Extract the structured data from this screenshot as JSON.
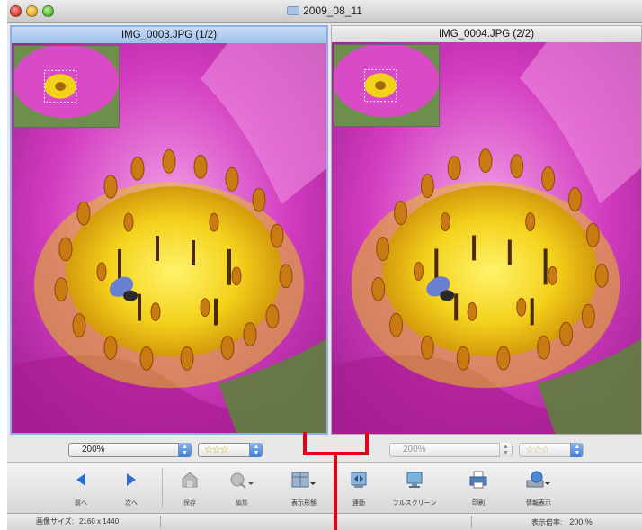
{
  "window": {
    "title": "2009_08_11"
  },
  "panels": {
    "left": {
      "filename": "IMG_0003.JPG (1/2)",
      "zoom": "200%",
      "rating": "☆☆☆"
    },
    "right": {
      "filename": "IMG_0004.JPG (2/2)",
      "zoom": "200%",
      "rating": "☆☆☆"
    }
  },
  "toolbar": {
    "items": [
      {
        "label": "前へ",
        "icon": "arrow-left-icon"
      },
      {
        "label": "次へ",
        "icon": "arrow-right-icon"
      },
      {
        "label": "保存",
        "icon": "save-icon"
      },
      {
        "label": "編集",
        "icon": "edit-icon"
      },
      {
        "label": "表示形態",
        "icon": "layout-icon"
      },
      {
        "label": "連動",
        "icon": "sync-icon"
      },
      {
        "label": "フルスクリーン",
        "icon": "fullscreen-icon"
      },
      {
        "label": "印刷",
        "icon": "print-icon"
      },
      {
        "label": "情報表示",
        "icon": "info-icon"
      }
    ]
  },
  "status": {
    "image_size_label": "画像サイズ:",
    "image_size_value": "2160 x 1440",
    "zoom_label": "表示倍率:",
    "zoom_value": "200 %"
  },
  "colors": {
    "accent": "#3d7fd8",
    "annotation": "#e3001b"
  }
}
